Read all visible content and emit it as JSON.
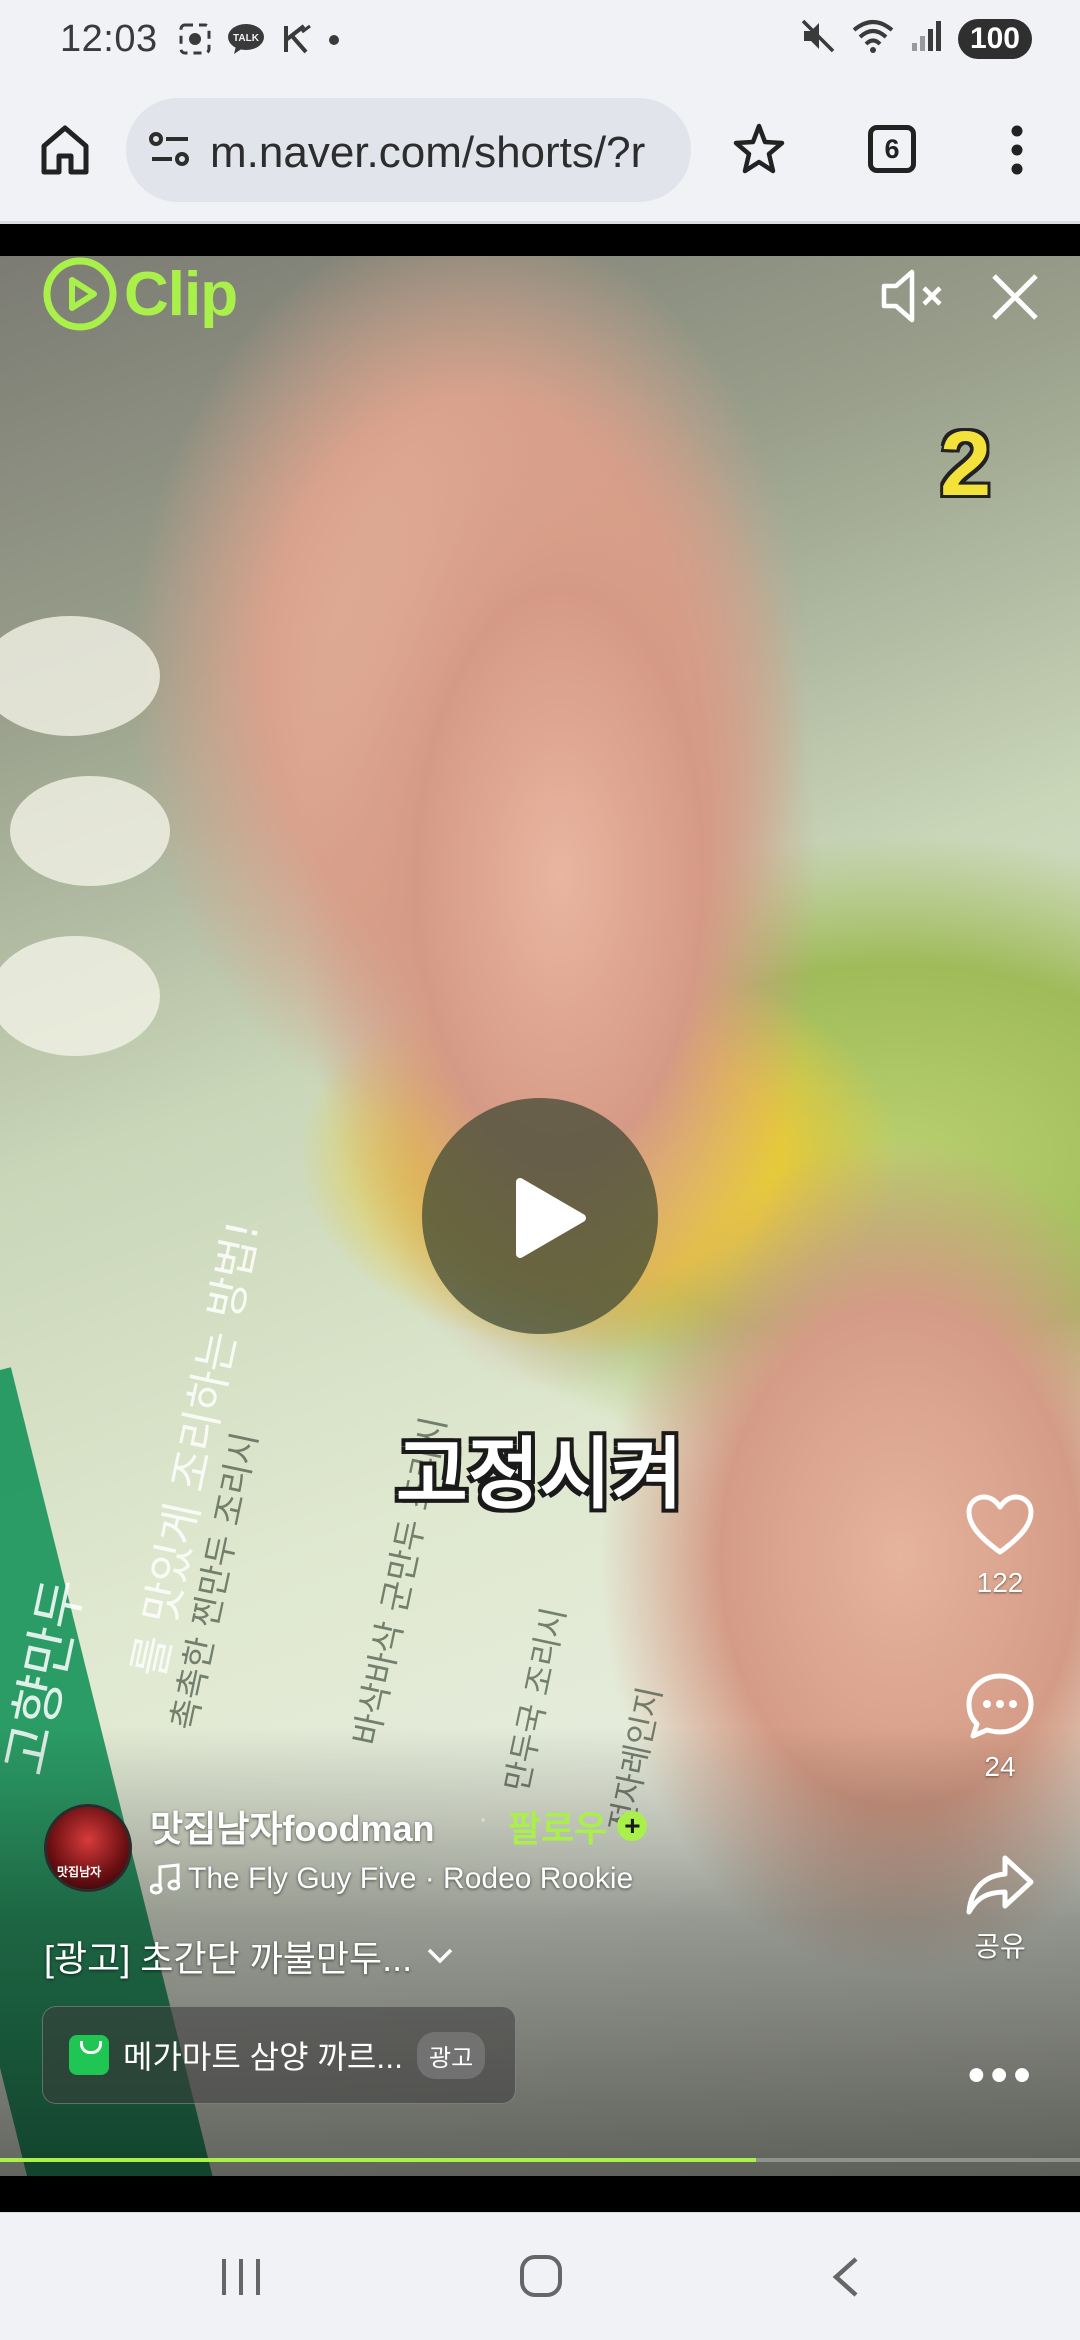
{
  "status_bar": {
    "time": "12:03",
    "notif_talk": "TALK",
    "battery": "100"
  },
  "browser": {
    "url": "m.naver.com/shorts/?r",
    "tab_count": "6"
  },
  "video": {
    "logo_text": "Clip",
    "overlay_number": "2",
    "subtitle": "고정시켜",
    "package_texts": [
      "고향만두",
      "를 맛있게 조리하는 방법!",
      "촉촉한 찐만두 조리시",
      "바삭바삭 군만두 조리시",
      "만두국 조리시",
      "전자레인지"
    ],
    "progress": 0.7
  },
  "actions": {
    "like_count": "122",
    "comment_count": "24",
    "share_label": "공유"
  },
  "author": {
    "name": "맛집남자foodman",
    "follow_label": "팔로우",
    "avatar_text": "맛집남자"
  },
  "music": {
    "track": "The Fly Guy Five · Rodeo Rookie"
  },
  "caption": {
    "text": "[광고] 초간단 까불만두..."
  },
  "ad": {
    "text": "메가마트 삼양 까르...",
    "badge": "광고"
  },
  "colors": {
    "accent": "#a9f04b",
    "subtitle_stroke": "#1a1a1a",
    "overlay_number": "#f3e23a"
  }
}
